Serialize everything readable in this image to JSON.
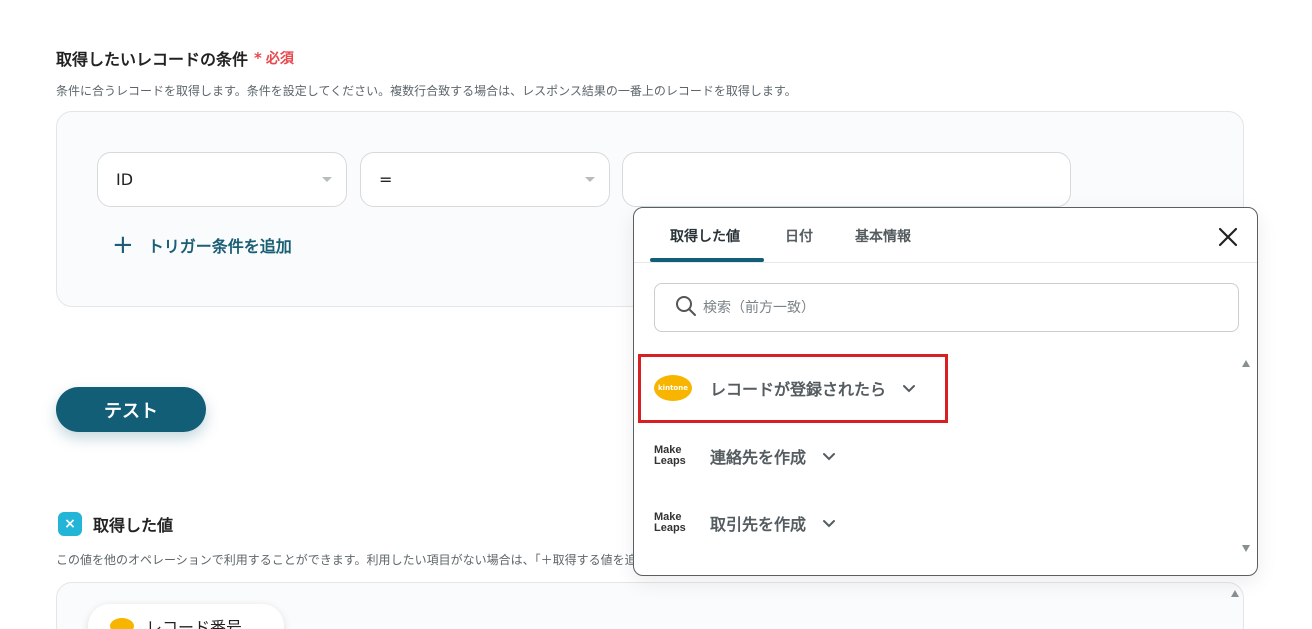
{
  "condition_section": {
    "title": "取得したいレコードの条件",
    "required_mark": "*",
    "required_label": "必須",
    "description": "条件に合うレコードを取得します。条件を設定してください。複数行合致する場合は、レスポンス結果の一番上のレコードを取得します。",
    "field_select": "ID",
    "operator_select": "=",
    "value_input": "",
    "add_condition_label": "トリガー条件を追加"
  },
  "test_button_label": "テスト",
  "retrieved_section": {
    "title": "取得した値",
    "description": "この値を他のオペレーションで利用することができます。利用したい項目がない場合は、「＋取得する値を追加」",
    "first_chip_label": "レコード番号"
  },
  "popup": {
    "tabs": [
      "取得した値",
      "日付",
      "基本情報"
    ],
    "active_tab": "取得した値",
    "search_placeholder": "検索（前方一致）",
    "items": [
      {
        "logo": "kintone",
        "label": "レコードが登録されたら"
      },
      {
        "logo": "MakeLeaps",
        "label": "連絡先を作成"
      },
      {
        "logo": "MakeLeaps",
        "label": "取引先を作成"
      }
    ],
    "logo_text": {
      "kintone": "kintone",
      "makeleaps_line1": "Make",
      "makeleaps_line2": "Leaps"
    }
  },
  "colors": {
    "accent": "#125e76",
    "required": "#e8484d",
    "highlight": "#d82022",
    "kintone": "#f7b500",
    "cyan_icon": "#22b5d8"
  }
}
